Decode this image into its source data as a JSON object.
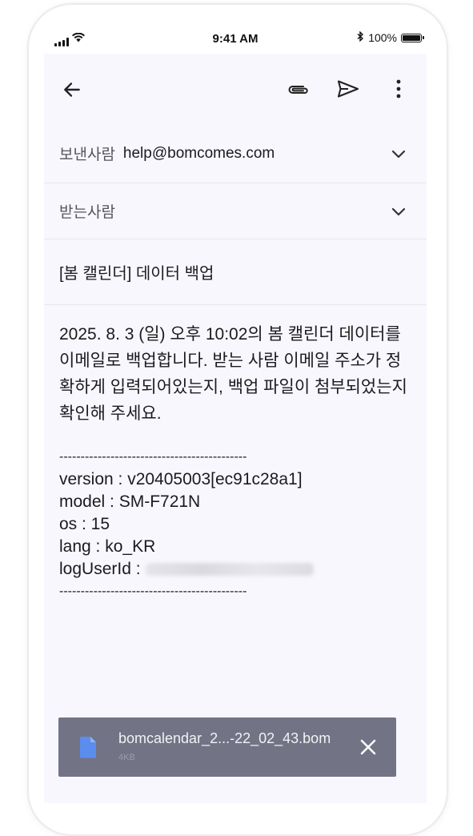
{
  "status_bar": {
    "time": "9:41 AM",
    "battery": "100%",
    "battery_level": 1.0,
    "icons": [
      "signal-icon",
      "wifi-icon",
      "bluetooth-icon",
      "battery-icon"
    ]
  },
  "toolbar": {
    "icons": [
      "back-arrow-icon",
      "attach-icon",
      "send-icon",
      "more-vert-icon"
    ]
  },
  "from_row": {
    "label": "보낸사람",
    "value": "help@bomcomes.com"
  },
  "to_row": {
    "label": "받는사람",
    "value": ""
  },
  "subject": "[봄 캘린더] 데이터 백업",
  "body": {
    "message": "2025. 8. 3 (일) 오후 10:02의 봄 캘린더 데이터를 이메일로 백업합니다. 받는 사람 이메일 주소가 정확하게 입력되어있는지, 백업 파일이 첨부되었는지 확인해 주세요.",
    "divider": "--------------------------------------------",
    "version": "version : v20405003[ec91c28a1]",
    "model": "model : SM-F721N",
    "os": "os : 15",
    "lang": "lang : ko_KR",
    "log_user_id_label": "logUserId :"
  },
  "attachment": {
    "name": "bomcalendar_2...-22_02_43.bom",
    "size": "4KB",
    "icon": "file-icon",
    "close_icon": "close-icon"
  },
  "colors": {
    "screen_bg": "#f8f7fd",
    "attachment_bg": "#727485",
    "file_icon": "#5b8def"
  }
}
